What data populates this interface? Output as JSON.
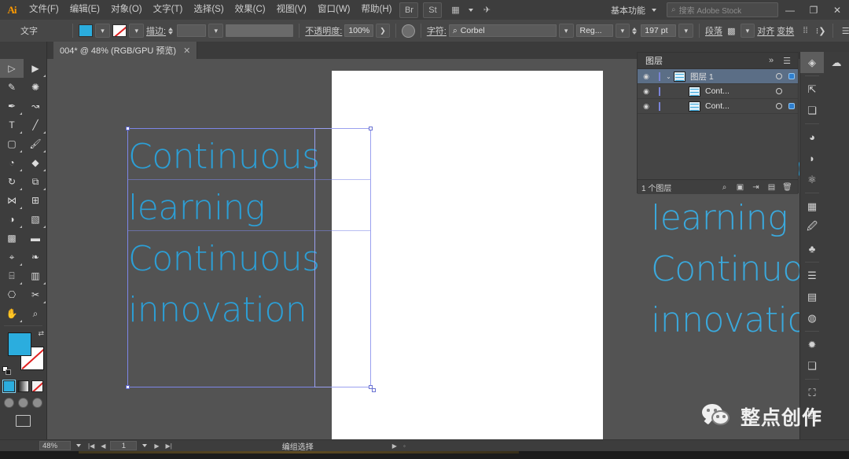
{
  "menubar": {
    "logo": "Ai",
    "items": [
      {
        "label": "文件(F)"
      },
      {
        "label": "编辑(E)"
      },
      {
        "label": "对象(O)"
      },
      {
        "label": "文字(T)"
      },
      {
        "label": "选择(S)"
      },
      {
        "label": "效果(C)"
      },
      {
        "label": "视图(V)"
      },
      {
        "label": "窗口(W)"
      },
      {
        "label": "帮助(H)"
      }
    ],
    "bridge_icon": "Br",
    "stock_icon": "St",
    "arrange_icon": "▦",
    "discover_icon": "✈",
    "workspace": "基本功能",
    "search_placeholder": "搜索 Adobe Stock",
    "search_icon": "⌕",
    "minimize": "—",
    "maximize": "❐",
    "close": "✕"
  },
  "controlbar": {
    "tool_label": "文字",
    "fill_label": "填色",
    "stroke_label": "描边",
    "stroke_weight_label": "描边:",
    "stroke_weight_value": "",
    "profile_value": "",
    "opacity_label": "不透明度:",
    "opacity_value": "100%",
    "char_label": "字符:",
    "font_family": "Corbel",
    "font_style": "Reg...",
    "font_size": "197",
    "font_size_unit": "pt",
    "paragraph_label": "段落",
    "align_label": "对齐",
    "transform_label": "变换",
    "search_icon": "⌕"
  },
  "tabbar": {
    "doc_title": "004* @ 48% (RGB/GPU 预览)",
    "close": "✕"
  },
  "toolbar": {
    "tools": [
      {
        "name": "selection-tool",
        "glyph": "▷",
        "active": true
      },
      {
        "name": "direct-selection-tool",
        "glyph": "▶",
        "active": false
      },
      {
        "name": "magic-wand-tool",
        "glyph": "✎",
        "active": false
      },
      {
        "name": "lasso-tool",
        "glyph": "✺",
        "active": false
      },
      {
        "name": "pen-tool",
        "glyph": "✒",
        "active": false
      },
      {
        "name": "curvature-tool",
        "glyph": "↝",
        "active": false
      },
      {
        "name": "type-tool",
        "glyph": "T",
        "active": false
      },
      {
        "name": "line-segment-tool",
        "glyph": "╱",
        "active": false
      },
      {
        "name": "rectangle-tool",
        "glyph": "▢",
        "active": false
      },
      {
        "name": "paintbrush-tool",
        "glyph": "🖌",
        "active": false
      },
      {
        "name": "shaper-tool",
        "glyph": "◔",
        "active": false
      },
      {
        "name": "eraser-tool",
        "glyph": "◆",
        "active": false
      },
      {
        "name": "rotate-tool",
        "glyph": "↻",
        "active": false
      },
      {
        "name": "scale-tool",
        "glyph": "⧉",
        "active": false
      },
      {
        "name": "width-tool",
        "glyph": "⋈",
        "active": false
      },
      {
        "name": "free-transform-tool",
        "glyph": "⊞",
        "active": false
      },
      {
        "name": "shape-builder-tool",
        "glyph": "◑",
        "active": false
      },
      {
        "name": "perspective-grid-tool",
        "glyph": "▧",
        "active": false
      },
      {
        "name": "mesh-tool",
        "glyph": "▩",
        "active": false
      },
      {
        "name": "gradient-tool",
        "glyph": "▬",
        "active": false
      },
      {
        "name": "eyedropper-tool",
        "glyph": "⌖",
        "active": false
      },
      {
        "name": "blend-tool",
        "glyph": "❧",
        "active": false
      },
      {
        "name": "symbol-sprayer-tool",
        "glyph": "⌸",
        "active": false
      },
      {
        "name": "column-graph-tool",
        "glyph": "▥",
        "active": false
      },
      {
        "name": "artboard-tool",
        "glyph": "⎔",
        "active": false
      },
      {
        "name": "slice-tool",
        "glyph": "✂",
        "active": false
      },
      {
        "name": "hand-tool",
        "glyph": "✋",
        "active": false
      },
      {
        "name": "zoom-tool",
        "glyph": "⌕",
        "active": false
      }
    ]
  },
  "canvas": {
    "artboard_text": "Continuous learning Continuous innovation",
    "selected_text": "Continuous learning Continuous innovation",
    "text_lines": [
      "Continuous",
      " learning",
      "Continuous",
      " innovation"
    ],
    "fill_color": "#2badde",
    "artboard_text_color": "#3aa9dd"
  },
  "layers_panel": {
    "title": "图层",
    "collapse_icon": "»",
    "menu_icon": "☰",
    "rows": [
      {
        "name": "图层 1",
        "selected": true,
        "eye": "◉",
        "expand": "⌄",
        "has_target": true,
        "has_selcolor": true
      },
      {
        "name": "Cont...",
        "selected": false,
        "eye": "◉",
        "expand": "",
        "has_target": true,
        "has_selcolor": false
      },
      {
        "name": "Cont...",
        "selected": false,
        "eye": "◉",
        "expand": "",
        "has_target": true,
        "has_selcolor": true
      }
    ],
    "footer_count": "1 个图层",
    "footer_icons": [
      "⌕",
      "▣",
      "⇥",
      "▤",
      "🗑"
    ]
  },
  "dock": {
    "column1": [
      {
        "name": "layers-icon",
        "glyph": "◈",
        "active": true
      },
      {
        "name": "export-icon",
        "glyph": "⇱"
      },
      {
        "name": "artboards-icon",
        "glyph": "❏"
      },
      {
        "name": "color-icon",
        "glyph": "◕"
      },
      {
        "name": "color-guide-icon",
        "glyph": "◗"
      },
      {
        "name": "recolor-icon",
        "glyph": "⚛"
      },
      {
        "name": "swatches-icon",
        "glyph": "▦"
      },
      {
        "name": "brushes-icon",
        "glyph": "🖉"
      },
      {
        "name": "symbols-icon",
        "glyph": "♣"
      },
      {
        "name": "stroke-icon",
        "glyph": "☰"
      },
      {
        "name": "gradient-icon",
        "glyph": "▤"
      },
      {
        "name": "transparency-icon",
        "glyph": "◍"
      },
      {
        "name": "appearance-icon",
        "glyph": "✹"
      },
      {
        "name": "graphic-styles-icon",
        "glyph": "❑"
      },
      {
        "name": "transform-icon",
        "glyph": "⛶"
      },
      {
        "name": "align-icon",
        "glyph": "▤"
      }
    ],
    "column2": [
      {
        "name": "libraries-icon",
        "glyph": "☁"
      }
    ]
  },
  "status": {
    "zoom": "48%",
    "artboard_num": "1",
    "tool_status": "编组选择",
    "nav_first": "|◀",
    "nav_prev": "◀",
    "nav_next": "▶",
    "nav_last": "▶|",
    "play": "▶",
    "more": "◦"
  },
  "watermark": {
    "text": "整点创作"
  }
}
